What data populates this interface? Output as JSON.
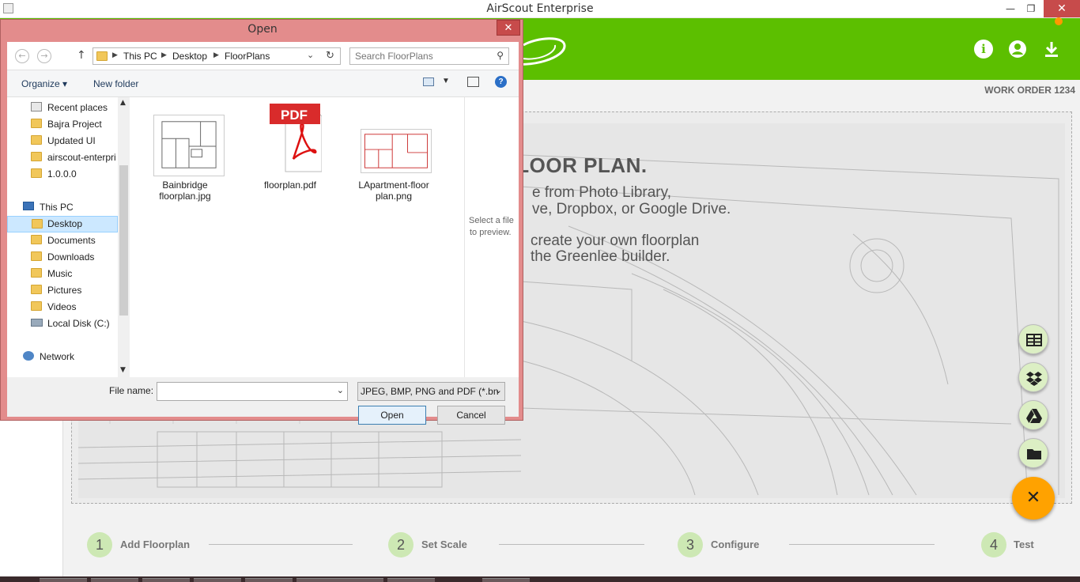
{
  "window": {
    "title": "AirScout Enterprise",
    "minimize": "—",
    "maximize": "❐",
    "close": "✕"
  },
  "header": {
    "info_label": "i",
    "brand_color": "#5cbf00",
    "accent_color": "#ffa200"
  },
  "main": {
    "work_order": "WORK ORDER 1234",
    "drop_title": "ED A FLOOR PLAN.",
    "drop_line1": "e from Photo Library,",
    "drop_line2": "ve, Dropbox, or Google Drive.",
    "drop_line3": "create your own floorplan",
    "drop_line4": "the Greenlee builder."
  },
  "fabs": {
    "close": "✕",
    "icons": [
      "table-icon",
      "dropbox-icon",
      "google-drive-icon",
      "folder-icon"
    ]
  },
  "steps": [
    {
      "num": "1",
      "label": "Add Floorplan"
    },
    {
      "num": "2",
      "label": "Set Scale"
    },
    {
      "num": "3",
      "label": "Configure"
    },
    {
      "num": "4",
      "label": "Test"
    }
  ],
  "dialog": {
    "title": "Open",
    "close": "✕",
    "breadcrumb": [
      "This PC",
      "Desktop",
      "FloorPlans"
    ],
    "search_placeholder": "Search FloorPlans",
    "toolbar": {
      "organize": "Organize ▾",
      "new_folder": "New folder",
      "help": "?"
    },
    "nav_items": [
      {
        "label": "Recent places"
      },
      {
        "label": "Bajra Project"
      },
      {
        "label": "Updated UI"
      },
      {
        "label": "airscout-enterpri"
      },
      {
        "label": "1.0.0.0"
      },
      {
        "label": "This PC"
      },
      {
        "label": "Desktop"
      },
      {
        "label": "Documents"
      },
      {
        "label": "Downloads"
      },
      {
        "label": "Music"
      },
      {
        "label": "Pictures"
      },
      {
        "label": "Videos"
      },
      {
        "label": "Local Disk (C:)"
      },
      {
        "label": "Network"
      }
    ],
    "files": [
      {
        "line1": "Bainbridge",
        "line2": "floorplan.jpg"
      },
      {
        "line1": "floorplan.pdf",
        "line2": "",
        "badge": "PDF"
      },
      {
        "line1": "LApartment-floor",
        "line2": "plan.png"
      }
    ],
    "preview_text1": "Select a file",
    "preview_text2": "to preview.",
    "filename_label": "File name:",
    "filename_value": "",
    "filetype_value": "JPEG, BMP, PNG and PDF  (*.bn",
    "open_button": "Open",
    "cancel_button": "Cancel"
  }
}
